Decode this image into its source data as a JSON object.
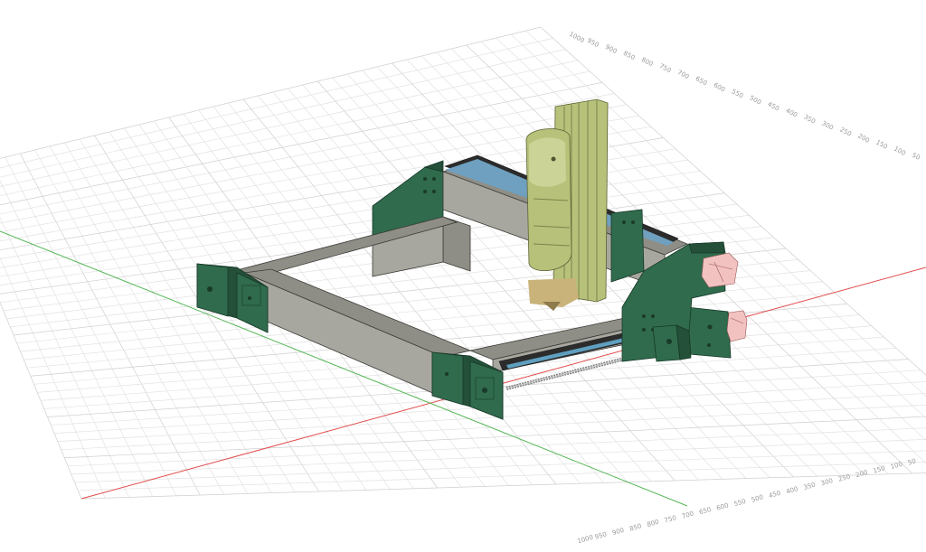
{
  "viewport": {
    "background": "#ffffff",
    "grid_color": "#e2e2e2",
    "grid_major_color": "#cfcfcf",
    "x_axis_color": "#e24b4b",
    "y_axis_color": "#57b857"
  },
  "model": {
    "frame_color": "#8b8a82",
    "plate_color": "#2f6b4c",
    "motor_color": "#b7c17a",
    "rail_color": "#2c2c2c",
    "accent_color": "#f0b8b6"
  },
  "ticks": {
    "right_edge": [
      "1000",
      "950",
      "900",
      "850",
      "800",
      "750",
      "700",
      "650",
      "600",
      "550",
      "500",
      "450",
      "400",
      "350",
      "300",
      "250",
      "200",
      "150",
      "100",
      "50"
    ],
    "bottom_edge": [
      "1000",
      "950",
      "900",
      "850",
      "800",
      "750",
      "700",
      "650",
      "600",
      "550",
      "500",
      "450",
      "400",
      "350",
      "300",
      "250",
      "200",
      "150",
      "100",
      "50"
    ]
  }
}
